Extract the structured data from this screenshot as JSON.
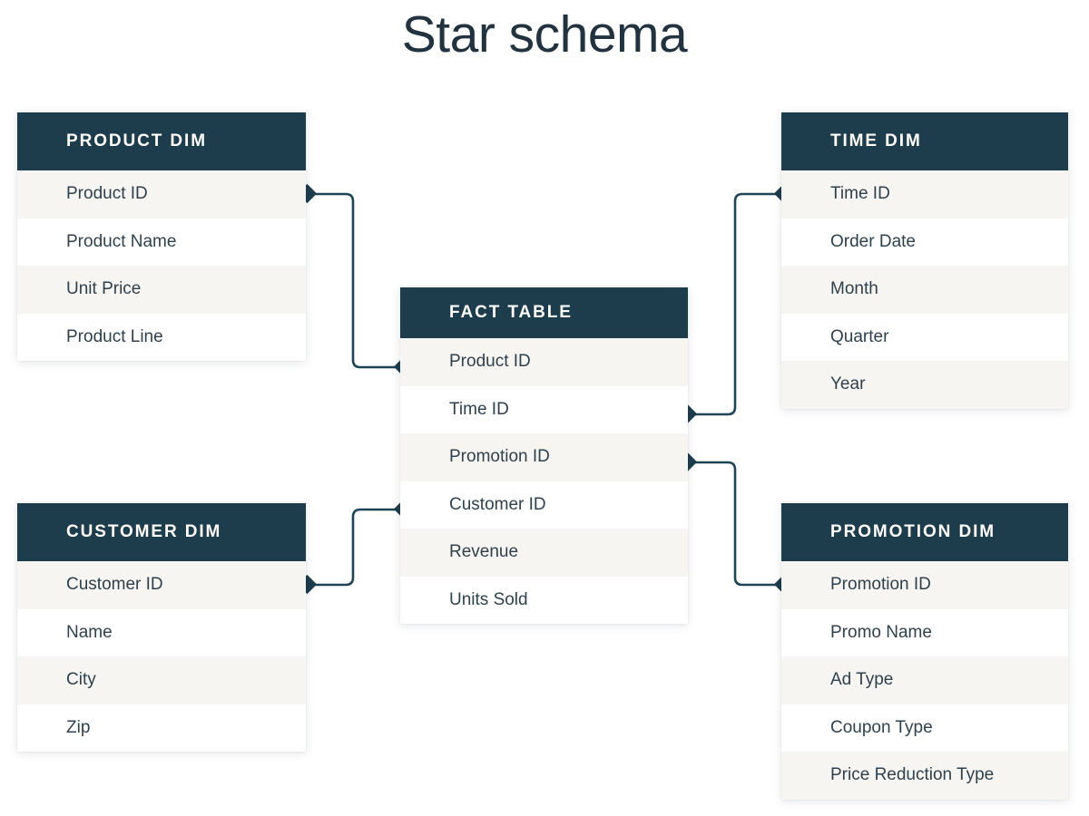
{
  "page": {
    "title": "Star schema",
    "background_color": "#ffffff",
    "accent_color": "#1d3c4c",
    "row_shade_color": "#f7f5f2",
    "text_color": "#2f414d",
    "connector_color": "#1f4455"
  },
  "tables": {
    "product": {
      "title": "PRODUCT DIM",
      "fields": [
        "Product ID",
        "Product Name",
        "Unit Price",
        "Product Line"
      ]
    },
    "time": {
      "title": "TIME DIM",
      "fields": [
        "Time ID",
        "Order Date",
        "Month",
        "Quarter",
        "Year"
      ]
    },
    "fact": {
      "title": "FACT TABLE",
      "fields": [
        "Product ID",
        "Time ID",
        "Promotion ID",
        "Customer ID",
        "Revenue",
        "Units Sold"
      ]
    },
    "customer": {
      "title": "CUSTOMER DIM",
      "fields": [
        "Customer ID",
        "Name",
        "City",
        "Zip"
      ]
    },
    "promotion": {
      "title": "PROMOTION DIM",
      "fields": [
        "Promotion ID",
        "Promo Name",
        "Ad Type",
        "Coupon Type",
        "Price Reduction Type"
      ]
    }
  },
  "relationships": [
    {
      "name": "product-to-fact",
      "from": "PRODUCT DIM.Product ID",
      "to": "FACT TABLE.Product ID"
    },
    {
      "name": "fact-to-time",
      "from": "FACT TABLE.Time ID",
      "to": "TIME DIM.Time ID"
    },
    {
      "name": "customer-to-fact",
      "from": "CUSTOMER DIM.Customer ID",
      "to": "FACT TABLE.Customer ID"
    },
    {
      "name": "fact-to-promotion",
      "from": "FACT TABLE.Promotion ID",
      "to": "PROMOTION DIM.Promotion ID"
    }
  ]
}
